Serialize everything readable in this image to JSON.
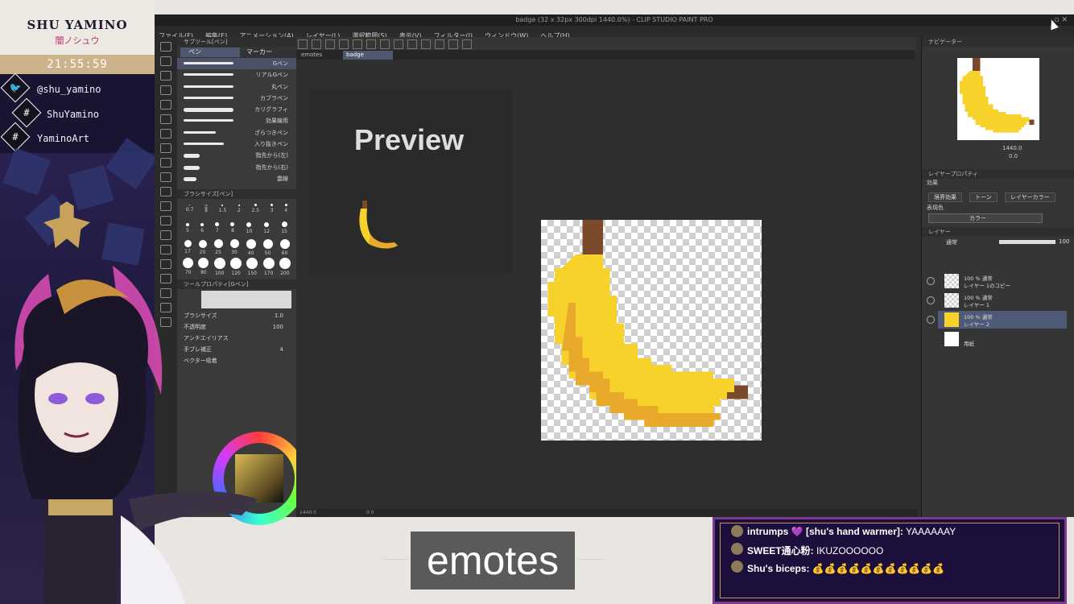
{
  "overlay": {
    "brand_name": "SHU YAMINO",
    "brand_jp": "闇ノシュウ",
    "clock": "21:55:59",
    "socials": [
      {
        "icon": "twitter-icon",
        "glyph": "🐦",
        "text": "@shu_yamino"
      },
      {
        "icon": "hashtag-icon",
        "glyph": "#",
        "text": "ShuYamino"
      },
      {
        "icon": "hashtag-icon",
        "glyph": "#",
        "text": "YaminoArt"
      }
    ],
    "caption": "emotes"
  },
  "app": {
    "title": "badge (32 x 32px 300dpi 1440.0%) - CLIP STUDIO PAINT PRO",
    "menu": [
      "ファイル(F)",
      "編集(E)",
      "アニメーション(A)",
      "レイヤー(L)",
      "選択範囲(S)",
      "表示(V)",
      "フィルター(I)",
      "ウィンドウ(W)",
      "ヘルプ(H)"
    ],
    "subtool": {
      "panel_title": "サブツール[ペン]",
      "tabs": [
        "ペン",
        "マーカー"
      ],
      "brushes": [
        "Gペン",
        "リアルGペン",
        "丸ペン",
        "カブラペン",
        "カリグラフィ",
        "効果線用",
        "ざらつきペン",
        "入り抜きペン",
        "指先から(左)",
        "指先から(右)",
        "震線"
      ],
      "selected_brush": "Gペン",
      "brush_size_title": "ブラシサイズ[ペン]",
      "sizes_row1": [
        "0.7",
        "1",
        "1.5",
        "2",
        "2.5",
        "3",
        "4"
      ],
      "sizes_row2": [
        "5",
        "6",
        "7",
        "8",
        "10",
        "12",
        "15"
      ],
      "sizes_row3": [
        "17",
        "20",
        "25",
        "30",
        "40",
        "50",
        "60"
      ],
      "sizes_row4": [
        "70",
        "80",
        "100",
        "120",
        "150",
        "170",
        "200"
      ],
      "toolprop_title": "ツールプロパティ[Gペン]",
      "props": [
        {
          "label": "ブラシサイズ",
          "value": "1.0"
        },
        {
          "label": "不透明度",
          "value": "100"
        },
        {
          "label": "アンチエイリアス",
          "value": ""
        },
        {
          "label": "手ブレ補正",
          "value": "4"
        },
        {
          "label": "ベクター吸着",
          "value": ""
        }
      ]
    },
    "doc_tabs": [
      "emotes",
      "badge"
    ],
    "active_doc_tab": "badge",
    "preview_label": "Preview",
    "status_zoom": "1440.0",
    "status_angle": "0.0",
    "navigator": {
      "title": "ナビゲーター",
      "zoom": "1440.0",
      "angle": "0.0"
    },
    "layer_property": {
      "title": "レイヤープロパティ",
      "effect_label": "効果",
      "buttons": [
        "境界効果",
        "トーン",
        "レイヤーカラー"
      ],
      "expression_color_label": "表現色",
      "expression_color": "カラー"
    },
    "layers_panel": {
      "title": "レイヤー",
      "blend_mode": "通常",
      "opacity": "100",
      "layers": [
        {
          "line1": "100 % 通常",
          "line2": "レイヤー 1のコピー",
          "selected": false
        },
        {
          "line1": "100 % 通常",
          "line2": "レイヤー 1",
          "selected": false
        },
        {
          "line1": "100 % 通常",
          "line2": "レイヤー 2",
          "selected": true
        },
        {
          "line1": "",
          "line2": "用紙",
          "selected": false
        }
      ]
    }
  },
  "chat": {
    "messages": [
      {
        "user": "intrumps",
        "badge": "💜",
        "tag": "[shu's hand warmer]:",
        "text": "YAAAAAAY"
      },
      {
        "user": "SWEET通心粉:",
        "badge": "",
        "tag": "",
        "text": "IKUZOOOOOO"
      },
      {
        "user": "Shu's biceps:",
        "badge": "",
        "tag": "",
        "text": "💰💰💰💰💰💰💰💰💰💰💰"
      }
    ]
  },
  "colors": {
    "banana_yellow": "#f7d22a",
    "banana_shade": "#e9a92a",
    "stem_brown": "#7a4a2a",
    "chat_bg": "#1d0f3c",
    "accent_pink": "#c0388a"
  }
}
